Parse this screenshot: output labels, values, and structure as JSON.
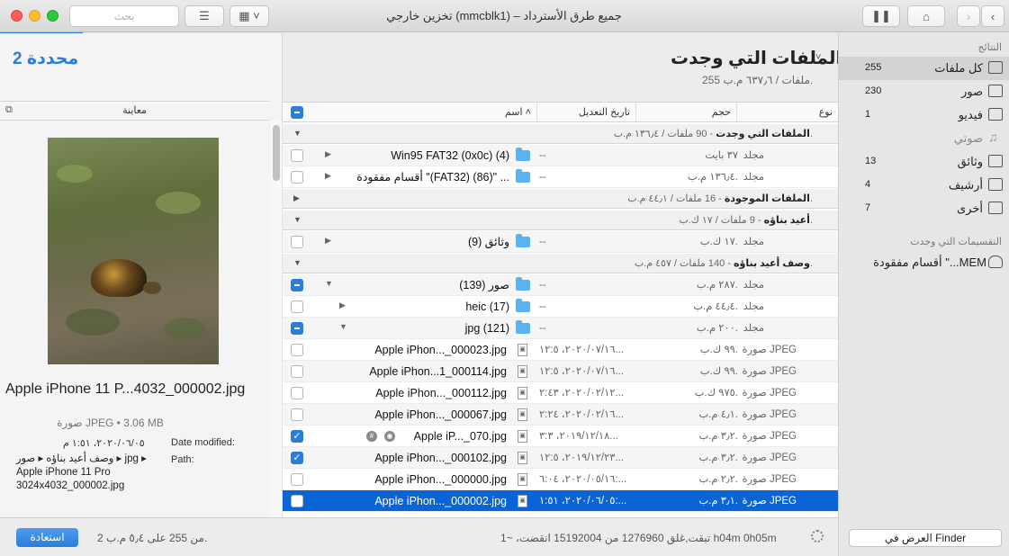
{
  "window": {
    "title": "تخزين خارجي (mmcblk1) – جميع طرق الأسترداد",
    "search_placeholder": "بحث"
  },
  "selection": {
    "count_label": "2 محددة"
  },
  "preview": {
    "header": "معاينة",
    "file_title": "Apple iPhone 11 P...4032_000002.jpg",
    "kind_line": "صورة JPEG • 3.06 MB",
    "date_label": "Date modified:",
    "date_value": "٢٠٢٠/٠٦/٠٥، ١:٥١ م",
    "path_label": "Path:",
    "path_value": "وصف أعيد بناؤه ▸ صور ▸ jpg ▸ Apple iPhone 11 Pro 3024x4032_000002.jpg"
  },
  "main": {
    "title": "الملفات التي وجدت",
    "subtitle": "255 ملفات / ٦٣٧٫٦ م.ب."
  },
  "table": {
    "columns": {
      "name": "اسم",
      "date": "تاريخ التعديل",
      "size": "حجم",
      "type": "نوع"
    },
    "groups": [
      {
        "title": "الملفات التي وجدت",
        "detail": " - 90 ملفات / ١٣٦٫٤ م.ب."
      },
      {
        "title": "الملفات الموجودة",
        "detail": " - 16 ملفات / ٤٤٫١ م.ب."
      },
      {
        "title": "أعيد بناؤه",
        "detail": " - 9 ملفات / ١٧ ك.ب."
      },
      {
        "title": "وصف أعيد بناؤه",
        "detail": " - 140 ملفات / ٤٥٧ م.ب."
      }
    ],
    "rows": [
      {
        "name": "Win95 FAT32 (0x0c) (4)",
        "date": "--",
        "size": "٣٧ بايت",
        "type": "مجلد"
      },
      {
        "name": "أقسام  مفقودة \"(FAT32) (86)\" ...",
        "date": "--",
        "size": "١٣٦٫٤ م.ب.",
        "type": "مجلد"
      },
      {
        "name": "وثائق (9)",
        "date": "--",
        "size": "١٧ ك.ب.",
        "type": "مجلد"
      },
      {
        "name": "صور (139)",
        "date": "--",
        "size": "٢٨٧ م.ب.",
        "type": "مجلد"
      },
      {
        "name": "heic (17)",
        "date": "--",
        "size": "٤٤٫٤ م.ب.",
        "type": "مجلد"
      },
      {
        "name": "jpg (121)",
        "date": "--",
        "size": "٢٠٠ م.ب.",
        "type": "مجلد"
      },
      {
        "name": "Apple iPhon..._000023.jpg",
        "date": "٢٠٢٠/٠٧/١٦، ١٢:٥...",
        "size": "٩٩ ك.ب.",
        "type": "صورة JPEG"
      },
      {
        "name": "Apple iPhon...1_000114.jpg",
        "date": "٢٠٢٠/٠٧/١٦، ١٢:٥...",
        "size": "٩٩ ك.ب.",
        "type": "صورة JPEG"
      },
      {
        "name": "Apple iPhon..._000112.jpg",
        "date": "٢٠٢٠/٠٢/١٢، ٢:٤٣...",
        "size": "٩٧٥ ك.ب.",
        "type": "صورة JPEG"
      },
      {
        "name": "Apple iPhon..._000067.jpg",
        "date": "٢٠٢٠/٠٢/١٦، ٢:٢٤...",
        "size": "٤٫١ م.ب.",
        "type": "صورة JPEG"
      },
      {
        "name": "Apple iP..._070.jpg",
        "date": "٢٠١٩/١٢/١٨، ٣:٣...",
        "size": "٣٫٢ م.ب.",
        "type": "صورة JPEG"
      },
      {
        "name": "Apple iPhon..._000102.jpg",
        "date": "٢٠١٩/١٢/٢٣، ١٢:٥...",
        "size": "٣٫٢ م.ب.",
        "type": "صورة JPEG"
      },
      {
        "name": "Apple iPhon..._000000.jpg",
        "date": "٢٠٢٠/٠٥/١٦، ٦:٠٤:...",
        "size": "٢٫٢ م.ب.",
        "type": "صورة JPEG"
      },
      {
        "name": "Apple iPhon..._000002.jpg",
        "date": "٢٠٢٠/٠٦/٠٥، ١:٥١:...",
        "size": "٣٫١ م.ب.",
        "type": "صورة JPEG"
      }
    ]
  },
  "sidebar": {
    "results_header": "النتائج",
    "partitions_header": "التقسيمات التي وجدت",
    "items": [
      {
        "label": "كل ملفات",
        "count": "255"
      },
      {
        "label": "صور",
        "count": "230"
      },
      {
        "label": "فيديو",
        "count": "1"
      },
      {
        "label": "صوتي",
        "count": ""
      },
      {
        "label": "وثائق",
        "count": "13"
      },
      {
        "label": "أرشيف",
        "count": "4"
      },
      {
        "label": "أخرى",
        "count": "7"
      }
    ],
    "partition": "أقسام  مفقودة \"...MEM",
    "finder_button": "العرض في Finder"
  },
  "bottom": {
    "restore_button": "استعادة",
    "selection_summary": "2 من 255 على ٥٫٤ م.ب.",
    "scan_status": "تبقت,غلق 1276960 من 15192004 انقضت، ~1 h04m 0h05m"
  }
}
